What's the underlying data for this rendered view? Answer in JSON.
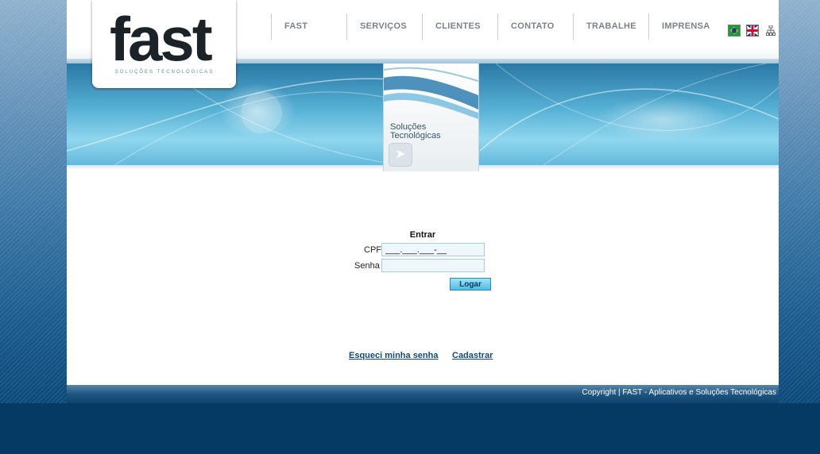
{
  "logo": {
    "text": "fast",
    "tagline": "Soluções Tecnológicas"
  },
  "nav": [
    "FAST",
    "SERVIÇOS",
    "CLIENTES",
    "CONTATO",
    "TRABALHE",
    "IMPRENSA"
  ],
  "banner": {
    "panel_line1": "Soluções",
    "panel_line2": "Tecnológicas"
  },
  "login": {
    "title": "Entrar",
    "cpf_label": "CPF",
    "cpf_value": "___.___.___-__",
    "senha_label": "Senha",
    "senha_value": "",
    "button": "Logar"
  },
  "links": {
    "forgot": "Esqueci minha senha",
    "register": "Cadastrar"
  },
  "footer": {
    "copyright": "Copyright | FAST - Aplicativos e Soluções Tecnológicas"
  },
  "icons": {
    "flag_pt": "brazil-flag-icon",
    "flag_en": "uk-flag-icon",
    "sitemap": "sitemap-icon"
  },
  "colors": {
    "link": "#124a7f",
    "button": "#4fbde2",
    "background": "#0d4a7c"
  }
}
